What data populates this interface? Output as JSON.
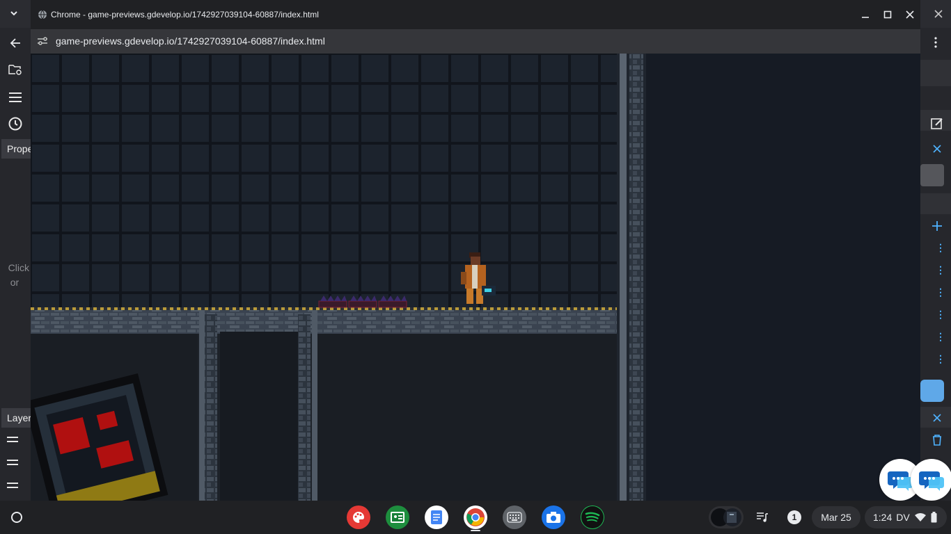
{
  "window": {
    "title": "Chrome - game-previews.gdevelop.io/1742927039104-60887/index.html",
    "url": "game-previews.gdevelop.io/1742927039104-60887/index.html",
    "controls": [
      "minimize-icon",
      "maximize-icon",
      "close-icon"
    ]
  },
  "background_editor": {
    "properties_tab": "Properties",
    "layers_tab": "Layers",
    "empty_hint_line1": "Click",
    "empty_hint_line2": "or"
  },
  "shelf": {
    "apps": [
      {
        "name": "Sketch app",
        "icon": "palette-icon",
        "color": "#e53935"
      },
      {
        "name": "Google Classroom",
        "icon": "classroom-icon",
        "color": "#1e8e3e"
      },
      {
        "name": "Google Docs",
        "icon": "docs-icon",
        "color": "#4285f4"
      },
      {
        "name": "Google Chrome",
        "icon": "chrome-icon",
        "color": "#4285f4"
      },
      {
        "name": "Launcher grid",
        "icon": "keyboard-icon",
        "color": "#5f6368"
      },
      {
        "name": "Camera",
        "icon": "camera-icon",
        "color": "#1a73e8"
      },
      {
        "name": "Spotify",
        "icon": "spotify-icon",
        "color": "#1db954"
      }
    ],
    "notification_count": "1",
    "date": "Mar 25",
    "time": "1:24",
    "user_initials": "DV"
  },
  "colors": {
    "shelf_bg": "#202124",
    "titlebar_bg": "#202124",
    "addressbar_bg": "#35363a",
    "game_bg": "#161b24",
    "accent_blue": "#4fb3ff"
  }
}
